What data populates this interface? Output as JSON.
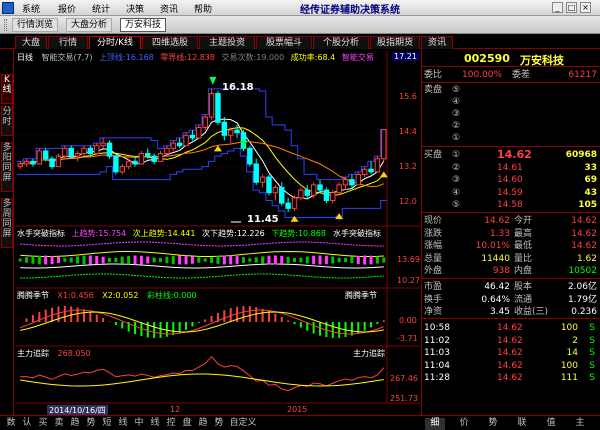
{
  "app": {
    "title": "经传证券辅助决策系统",
    "menus": [
      "系统",
      "报价",
      "统计",
      "决策",
      "资讯",
      "帮助"
    ]
  },
  "toolbar": {
    "items": [
      "行情浏览",
      "大盘分析",
      "万安科技"
    ],
    "active": 2
  },
  "tabs": {
    "items": [
      "大盘",
      "行情",
      "分时/K线",
      "四维选股",
      "主题投资",
      "股票幅斗",
      "个股分析",
      "股指期货",
      "资讯"
    ],
    "active": 2
  },
  "vtabs": {
    "items": [
      "K线",
      "分时",
      "多阳同屏",
      "多周同屏"
    ],
    "active": 0
  },
  "chart": {
    "main_legend": [
      {
        "text": "日线",
        "color": "#ffffff"
      },
      {
        "text": "智能交易(7,7)",
        "color": "#c0c0c0"
      },
      {
        "text": "上顶线:16.168",
        "color": "#4060ff"
      },
      {
        "text": "零界线:12.838",
        "color": "#ff4040"
      },
      {
        "text": "交易次数:19.000",
        "color": "#808080"
      },
      {
        "text": "成功率:68.4",
        "color": "#ffff00"
      },
      {
        "text": "智能交易",
        "color": "#ff40ff"
      }
    ],
    "cursor_price": "17.21",
    "price_ticks": [
      "15.6",
      "14.4",
      "13.2",
      "12.0"
    ],
    "high_label": "16.18",
    "low_label": "11.45",
    "ind1_legend": [
      {
        "text": "水手突破指标",
        "color": "#ffffff"
      },
      {
        "text": "上趋势:15.754",
        "color": "#ff40ff"
      },
      {
        "text": "次上趋势:14.441",
        "color": "#ffff00"
      },
      {
        "text": "次下趋势:12.226",
        "color": "#ffffff"
      },
      {
        "text": "下趋势:10.868",
        "color": "#00ff00"
      }
    ],
    "ind1_title_right": "水手突破指标",
    "ind1_ticks": [
      "13.69",
      "10.27"
    ],
    "ind2_legend": [
      {
        "text": "腾腾季节",
        "color": "#ffffff"
      },
      {
        "text": "X1:0.456",
        "color": "#ff4040"
      },
      {
        "text": "X2:0.052",
        "color": "#ffff00"
      },
      {
        "text": "彩柱线:0.000",
        "color": "#00ff00"
      }
    ],
    "ind2_title_right": "腾腾季节",
    "ind2_ticks": [
      "0.00",
      "-3.71"
    ],
    "ind3_legend": [
      {
        "text": "主力追踪",
        "color": "#ffffff"
      },
      {
        "text": "268.050",
        "color": "#ff4040"
      }
    ],
    "ind3_title_right": "主力追踪",
    "ind3_ticks": [
      "267.46",
      "251.73"
    ],
    "date_axis": {
      "cursor_date": "2014/10/16/四",
      "labels": [
        "12",
        "2015"
      ]
    }
  },
  "chart_data": {
    "type": "candlestick",
    "title": "万安科技 日线",
    "series": [
      {
        "name": "K线",
        "ohlc": [
          [
            13.2,
            13.4,
            13.1,
            13.3
          ],
          [
            13.3,
            13.5,
            13.2,
            13.4
          ],
          [
            13.4,
            13.5,
            13.2,
            13.3
          ],
          [
            13.3,
            13.9,
            13.3,
            13.8
          ],
          [
            13.8,
            13.9,
            13.4,
            13.5
          ],
          [
            13.5,
            13.6,
            13.1,
            13.2
          ],
          [
            13.2,
            13.7,
            13.2,
            13.6
          ],
          [
            13.6,
            14.0,
            13.5,
            13.9
          ],
          [
            13.9,
            14.0,
            13.5,
            13.6
          ],
          [
            13.6,
            13.8,
            13.4,
            13.7
          ],
          [
            13.7,
            14.0,
            13.6,
            13.9
          ],
          [
            13.9,
            14.0,
            13.6,
            13.7
          ],
          [
            13.7,
            14.1,
            13.7,
            14.0
          ],
          [
            14.0,
            14.3,
            13.9,
            14.1
          ],
          [
            14.1,
            14.2,
            13.5,
            13.6
          ],
          [
            13.6,
            13.7,
            12.9,
            13.0
          ],
          [
            13.0,
            13.3,
            12.9,
            13.2
          ],
          [
            13.2,
            13.5,
            13.1,
            13.4
          ],
          [
            13.4,
            13.6,
            13.2,
            13.3
          ],
          [
            13.3,
            13.8,
            13.3,
            13.7
          ],
          [
            13.7,
            13.9,
            13.5,
            13.6
          ],
          [
            13.6,
            13.7,
            13.3,
            13.4
          ],
          [
            13.4,
            13.8,
            13.4,
            13.7
          ],
          [
            13.7,
            14.0,
            13.6,
            13.9
          ],
          [
            13.9,
            14.2,
            13.8,
            14.1
          ],
          [
            14.1,
            14.3,
            13.9,
            14.0
          ],
          [
            14.0,
            14.5,
            14.0,
            14.4
          ],
          [
            14.4,
            14.6,
            14.2,
            14.3
          ],
          [
            14.3,
            14.8,
            14.3,
            14.7
          ],
          [
            14.7,
            15.2,
            14.6,
            15.1
          ],
          [
            15.1,
            16.18,
            15.0,
            16.0
          ],
          [
            16.0,
            16.1,
            14.8,
            14.9
          ],
          [
            14.9,
            15.1,
            14.2,
            14.4
          ],
          [
            14.4,
            14.7,
            14.1,
            14.6
          ],
          [
            14.6,
            14.8,
            14.3,
            14.5
          ],
          [
            14.5,
            14.6,
            13.8,
            13.9
          ],
          [
            13.9,
            14.0,
            13.2,
            13.3
          ],
          [
            13.3,
            13.5,
            12.5,
            12.6
          ],
          [
            12.6,
            12.9,
            12.4,
            12.8
          ],
          [
            12.8,
            12.9,
            12.1,
            12.2
          ],
          [
            12.2,
            12.5,
            11.9,
            12.4
          ],
          [
            12.4,
            12.6,
            11.7,
            11.8
          ],
          [
            11.8,
            12.0,
            11.45,
            11.6
          ],
          [
            11.6,
            12.1,
            11.5,
            12.0
          ],
          [
            12.0,
            12.4,
            11.9,
            12.3
          ],
          [
            12.3,
            12.5,
            12.0,
            12.1
          ],
          [
            12.1,
            12.6,
            12.0,
            12.5
          ],
          [
            12.5,
            12.7,
            12.2,
            12.3
          ],
          [
            12.3,
            12.4,
            11.8,
            11.9
          ],
          [
            11.9,
            12.3,
            11.8,
            12.2
          ],
          [
            12.2,
            12.6,
            12.1,
            12.5
          ],
          [
            12.5,
            12.8,
            12.3,
            12.7
          ],
          [
            12.7,
            12.9,
            12.4,
            12.5
          ],
          [
            12.5,
            13.0,
            12.5,
            12.9
          ],
          [
            12.9,
            13.2,
            12.8,
            13.1
          ],
          [
            13.1,
            13.4,
            12.9,
            13.0
          ],
          [
            13.0,
            13.6,
            13.0,
            13.5
          ],
          [
            13.5,
            14.62,
            13.4,
            14.62
          ]
        ]
      }
    ],
    "ylim": [
      11.0,
      17.21
    ],
    "yticks": [
      15.6,
      14.4,
      13.2,
      12.0
    ]
  },
  "panel": {
    "code": "002590",
    "name": "万安科技",
    "weibi": {
      "label": "委比",
      "pct": "100.00%",
      "label2": "委差",
      "val": "61217"
    },
    "sell": [
      {
        "label": "卖盘",
        "num": "⑤",
        "price": "",
        "vol": ""
      },
      {
        "label": "",
        "num": "④",
        "price": "",
        "vol": ""
      },
      {
        "label": "",
        "num": "③",
        "price": "",
        "vol": ""
      },
      {
        "label": "",
        "num": "②",
        "price": "",
        "vol": ""
      },
      {
        "label": "",
        "num": "①",
        "price": "",
        "vol": ""
      }
    ],
    "buy": [
      {
        "label": "买盘",
        "num": "①",
        "price": "14.62",
        "vol": "60968"
      },
      {
        "label": "",
        "num": "②",
        "price": "14.61",
        "vol": "33"
      },
      {
        "label": "",
        "num": "③",
        "price": "14.60",
        "vol": "69"
      },
      {
        "label": "",
        "num": "④",
        "price": "14.59",
        "vol": "43"
      },
      {
        "label": "",
        "num": "⑤",
        "price": "14.58",
        "vol": "105"
      }
    ],
    "stats": [
      {
        "l1": "现价",
        "v1": "14.62",
        "c1": "#ff4040",
        "l2": "今开",
        "v2": "14.62",
        "c2": "#ff4040"
      },
      {
        "l1": "涨跌",
        "v1": "1.33",
        "c1": "#ff4040",
        "l2": "最高",
        "v2": "14.62",
        "c2": "#ff4040"
      },
      {
        "l1": "涨幅",
        "v1": "10.01%",
        "c1": "#ff4040",
        "l2": "最低",
        "v2": "14.62",
        "c2": "#ff4040"
      },
      {
        "l1": "总量",
        "v1": "11440",
        "c1": "#ffff40",
        "l2": "量比",
        "v2": "1.62",
        "c2": "#ffff40"
      },
      {
        "l1": "外盘",
        "v1": "938",
        "c1": "#ff4040",
        "l2": "内盘",
        "v2": "10502",
        "c2": "#00ff00"
      }
    ],
    "stats2": [
      {
        "l1": "市盈",
        "v1": "46.42",
        "l2": "股本",
        "v2": "2.06亿"
      },
      {
        "l1": "换手",
        "v1": "0.64%",
        "l2": "流通",
        "v2": "1.79亿"
      },
      {
        "l1": "净资",
        "v1": "3.45",
        "l2": "收益(三)",
        "v2": "0.236"
      }
    ],
    "ticks": [
      {
        "time": "10:58",
        "price": "14.62",
        "vol": "100",
        "side": "S"
      },
      {
        "time": "11:02",
        "price": "14.62",
        "vol": "2",
        "side": "S"
      },
      {
        "time": "11:03",
        "price": "14.62",
        "vol": "14",
        "side": "S"
      },
      {
        "time": "11:04",
        "price": "14.62",
        "vol": "100",
        "side": "S"
      },
      {
        "time": "11:28",
        "price": "14.62",
        "vol": "111",
        "side": "S"
      }
    ]
  },
  "bottom_tabs": {
    "left": [
      "数",
      "认",
      "买",
      "卖",
      "趋",
      "势",
      "短",
      "线",
      "中",
      "线",
      "控",
      "盘",
      "趋",
      "势",
      "自定义"
    ],
    "right": [
      "细",
      "价",
      "势",
      "联",
      "值",
      "主"
    ],
    "active_right": 0
  },
  "colors": {
    "up": "#ff4040",
    "down": "#00ffff",
    "grid": "#800000",
    "price_up": "#ff4040"
  }
}
